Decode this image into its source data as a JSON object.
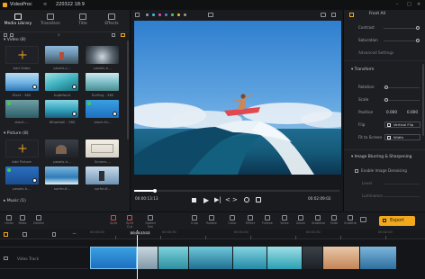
{
  "app": {
    "name": "VideoProc",
    "project": "220322 18:9"
  },
  "media_tabs": [
    {
      "label": "Media Library"
    },
    {
      "label": "Transition"
    },
    {
      "label": "Title"
    },
    {
      "label": "Effects"
    }
  ],
  "video_section": {
    "header": "Video (8)",
    "add_label": "Add Video",
    "items": [
      {
        "name": "pexels-c..."
      },
      {
        "name": "pexels-h..."
      },
      {
        "name": "Elect - 360"
      },
      {
        "name": "hqdefault"
      },
      {
        "name": "Surfing - 360"
      },
      {
        "name": "stock-..."
      },
      {
        "name": "Whaletail - 360"
      },
      {
        "name": "stock-th..."
      }
    ]
  },
  "picture_section": {
    "header": "Picture (8)",
    "add_label": "Add Picture",
    "items": [
      {
        "name": "pexels-h..."
      },
      {
        "name": "Screen-..."
      },
      {
        "name": "pexels-h..."
      },
      {
        "name": "surfer-6..."
      },
      {
        "name": "surfer-6..."
      }
    ]
  },
  "music_section": {
    "header": "Music (1)"
  },
  "preview": {
    "time_current": "00:00:13:13",
    "time_total": "00:02:09:02"
  },
  "right_panel": {
    "title": "Front All",
    "contrast_label": "Contrast",
    "saturation_label": "Saturation",
    "advanced_label": "Advanced Settings",
    "transform_header": "Transform",
    "rotation_label": "Rotation",
    "scale_label": "Scale",
    "position_label": "Position",
    "position_x": "0.000",
    "position_y": "0.000",
    "flip_label": "Flip",
    "flip_value": "Vertical Flip",
    "fit_label": "Fit to Screen",
    "fit_value": "Width",
    "denoise_header": "Image Blurring & Sharpening",
    "denoise_label": "Enable Image Denoising",
    "denoise_level": "Level",
    "denoise_luminance": "Luminance"
  },
  "toolbar": {
    "items": [
      {
        "label": "Undo"
      },
      {
        "label": "Redo"
      },
      {
        "label": "Delete"
      },
      {
        "label": "Split"
      },
      {
        "label": "Split Cut"
      },
      {
        "label": "Speed Set"
      },
      {
        "label": "Crop"
      },
      {
        "label": "Rotate"
      },
      {
        "label": "Color"
      },
      {
        "label": "Effect"
      },
      {
        "label": "Freeze"
      },
      {
        "label": "Voice"
      },
      {
        "label": "Zoom"
      },
      {
        "label": "Stabilize"
      },
      {
        "label": "Fade"
      },
      {
        "label": "Subtitle"
      }
    ],
    "export_label": "Export"
  },
  "timeline": {
    "playhead_time": "00:00:13:13",
    "track_video_label": "Video Track",
    "ruler_marks": [
      "00:00:00",
      "00:00:30",
      "00:01:00",
      "00:01:30",
      "00:02:00"
    ]
  },
  "colors": {
    "accent": "#f2a81d",
    "split_red": "#e04848"
  }
}
